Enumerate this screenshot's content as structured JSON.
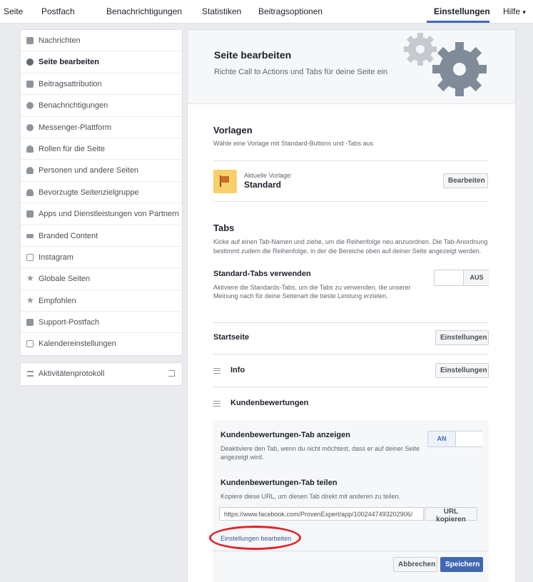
{
  "topnav": {
    "items": [
      "Seite",
      "Postfach",
      "Benachrichtigungen",
      "Statistiken",
      "Beitragsoptionen",
      "Einstellungen",
      "Hilfe"
    ],
    "help_arrow": "▾",
    "active": "Einstellungen"
  },
  "sidebar": {
    "items": [
      {
        "label": "Nachrichten",
        "icon": "chat-icon"
      },
      {
        "label": "Seite bearbeiten",
        "icon": "gear-icon"
      },
      {
        "label": "Beitragsattribution",
        "icon": "flag-icon"
      },
      {
        "label": "Benachrichtigungen",
        "icon": "globe-icon"
      },
      {
        "label": "Messenger-Plattform",
        "icon": "messenger-icon"
      },
      {
        "label": "Rollen für die Seite",
        "icon": "person-icon"
      },
      {
        "label": "Personen und andere Seiten",
        "icon": "person-add-icon"
      },
      {
        "label": "Bevorzugte Seitenzielgruppe",
        "icon": "person-add-icon"
      },
      {
        "label": "Apps und Dienstleistungen von Partnern",
        "icon": "box-icon"
      },
      {
        "label": "Branded Content",
        "icon": "handshake-icon"
      },
      {
        "label": "Instagram",
        "icon": "instagram-icon"
      },
      {
        "label": "Globale Seiten",
        "icon": "star-icon"
      },
      {
        "label": "Empfohlen",
        "icon": "star-icon"
      },
      {
        "label": "Support-Postfach",
        "icon": "facebook-icon"
      },
      {
        "label": "Kalendereinstellungen",
        "icon": "calendar-icon"
      }
    ],
    "active_index": 1,
    "activity_log": "Aktivitätenprotokoll"
  },
  "header": {
    "title": "Seite bearbeiten",
    "subtitle": "Richte Call to Actions und Tabs für deine Seite ein"
  },
  "templates": {
    "title": "Vorlagen",
    "desc": "Wähle eine Vorlage mit Standard-Buttons und -Tabs aus",
    "current_label": "Aktuelle Vorlage:",
    "current_value": "Standard",
    "edit_button": "Bearbeiten"
  },
  "tabs": {
    "title": "Tabs",
    "desc1": "Kicke auf einen Tab-Namen und ziehe, um die Reihenfolge neu anzuordnen. Die Tab-Anordnung",
    "desc2": "bestimmt zudem die Reihenfolge, in der die Bereiche oben auf deiner Seite angezeigt werden.",
    "standard_title": "Standard-Tabs verwenden",
    "standard_desc1": "Aktiviere die Standards-Tabs, um die Tabs zu verwenden, die unserer",
    "standard_desc2": "Meinung nach für deine Seitenart die beste Leistung erzielen.",
    "standard_toggle": "AUS",
    "rows": [
      {
        "label": "Startseite",
        "button": "Einstellungen"
      },
      {
        "label": "Info",
        "button": "Einstellungen"
      },
      {
        "label": "Kundenbewertungen"
      }
    ]
  },
  "reviews": {
    "show_title": "Kundenbewertungen-Tab anzeigen",
    "show_desc1": "Deaktiviere den Tab, wenn du nicht möchtest, dass er auf deiner Seite",
    "show_desc2": "angezeigt wird.",
    "show_toggle": "AN",
    "share_title": "Kundenbewertungen-Tab teilen",
    "share_desc": "Kopiere diese URL, um diesen Tab direkt mit anderen zu teilen.",
    "url": "https://www.facebook.com/ProvenExpert/app/1002447493202906/",
    "copy_button": "URL kopieren",
    "edit_link": "Einstellungen bearbeiten",
    "cancel_button": "Abbrechen",
    "save_button": "Speichern"
  },
  "colors": {
    "accent": "#4267b2",
    "highlight": "#e0242a",
    "template_icon": "#f7d06b"
  }
}
